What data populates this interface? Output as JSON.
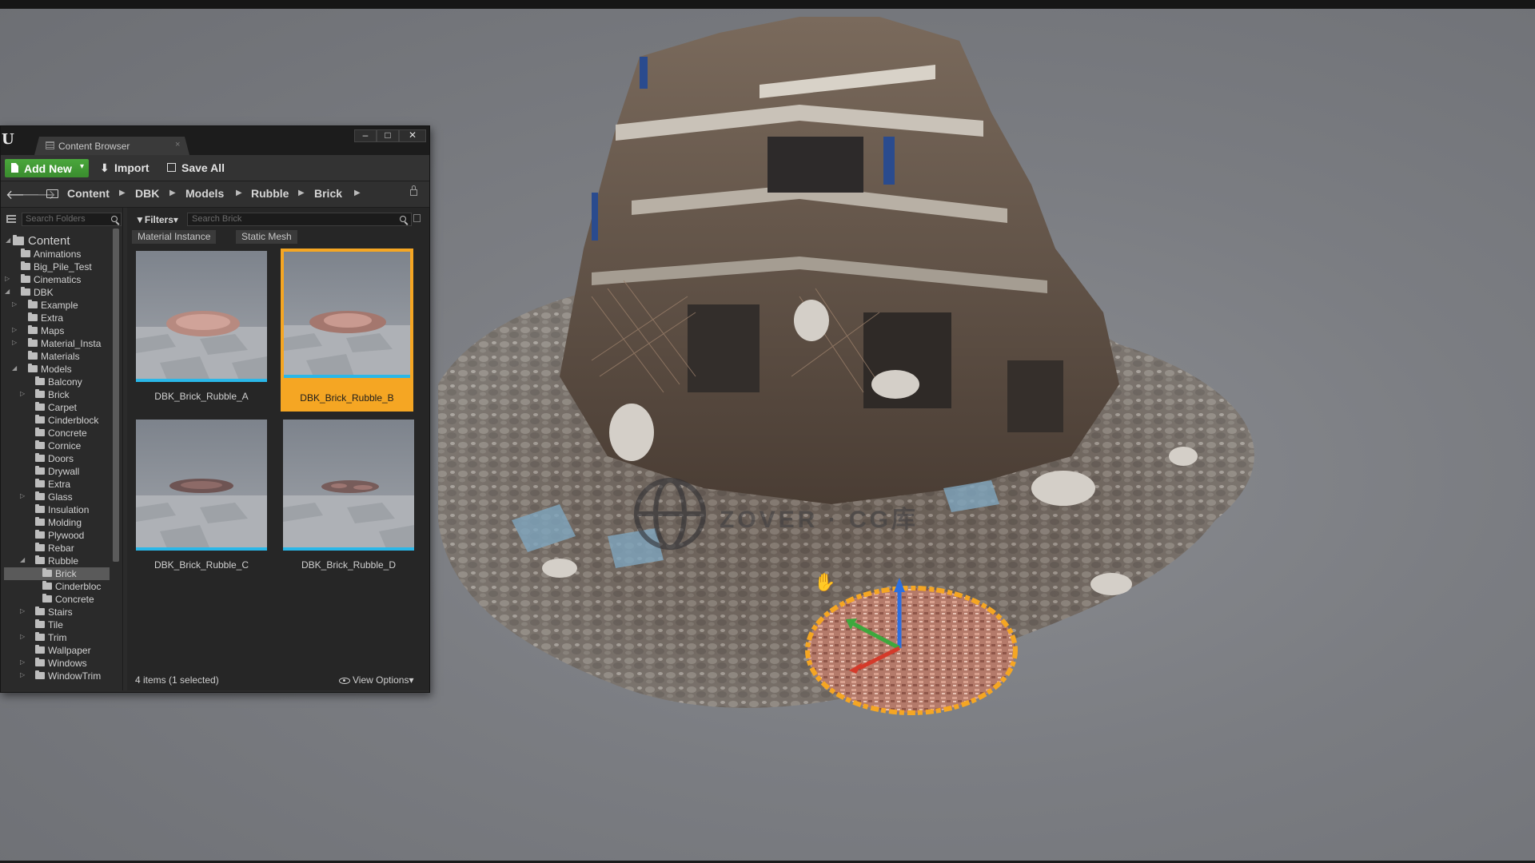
{
  "window": {
    "tab_title": "Content Browser",
    "tab_close": "×",
    "minimize": "–",
    "maximize": "□",
    "close": "✕",
    "logo": "U"
  },
  "toolbar": {
    "add_new_label": "Add New",
    "add_new_caret": "▾",
    "import_label": "Import",
    "import_icon": "⬇",
    "save_all_label": "Save All"
  },
  "nav": {
    "back": "🡐",
    "forward": "🡒"
  },
  "breadcrumb": {
    "items": [
      "Content",
      "DBK",
      "Models",
      "Rubble",
      "Brick"
    ],
    "separator": "▶"
  },
  "tree": {
    "search_placeholder": "Search Folders",
    "root": "Content",
    "items": [
      {
        "label": "Animations"
      },
      {
        "label": "Big_Pile_Test"
      },
      {
        "label": "Cinematics"
      },
      {
        "label": "DBK"
      },
      {
        "label": "Example"
      },
      {
        "label": "Extra"
      },
      {
        "label": "Maps"
      },
      {
        "label": "Material_Insta"
      },
      {
        "label": "Materials"
      },
      {
        "label": "Models"
      },
      {
        "label": "Balcony"
      },
      {
        "label": "Brick"
      },
      {
        "label": "Carpet"
      },
      {
        "label": "Cinderblock"
      },
      {
        "label": "Concrete"
      },
      {
        "label": "Cornice"
      },
      {
        "label": "Doors"
      },
      {
        "label": "Drywall"
      },
      {
        "label": "Extra"
      },
      {
        "label": "Glass"
      },
      {
        "label": "Insulation"
      },
      {
        "label": "Molding"
      },
      {
        "label": "Plywood"
      },
      {
        "label": "Rebar"
      },
      {
        "label": "Rubble"
      },
      {
        "label": "Brick"
      },
      {
        "label": "Cinderbloc"
      },
      {
        "label": "Concrete"
      },
      {
        "label": "Stairs"
      },
      {
        "label": "Tile"
      },
      {
        "label": "Trim"
      },
      {
        "label": "Wallpaper"
      },
      {
        "label": "Windows"
      },
      {
        "label": "WindowTrim"
      }
    ]
  },
  "assets": {
    "filters_label": "Filters",
    "filters_caret": "▾",
    "search_placeholder": "Search Brick",
    "type_filters": [
      "Material Instance",
      "Static Mesh"
    ],
    "items": [
      {
        "name": "DBK_Brick_Rubble_A"
      },
      {
        "name": "DBK_Brick_Rubble_B"
      },
      {
        "name": "DBK_Brick_Rubble_C"
      },
      {
        "name": "DBK_Brick_Rubble_D"
      }
    ],
    "status": "4 items (1 selected)",
    "view_options": "View Options",
    "view_options_caret": "▾"
  },
  "viewport": {
    "watermark": "ZOVER · CG库",
    "cursor": "✋"
  },
  "colors": {
    "accent_green": "#3a8c2e",
    "selection_orange": "#f5a623",
    "thumb_bar_blue": "#2ab7e8",
    "panel_bg": "#2b2b2b"
  }
}
